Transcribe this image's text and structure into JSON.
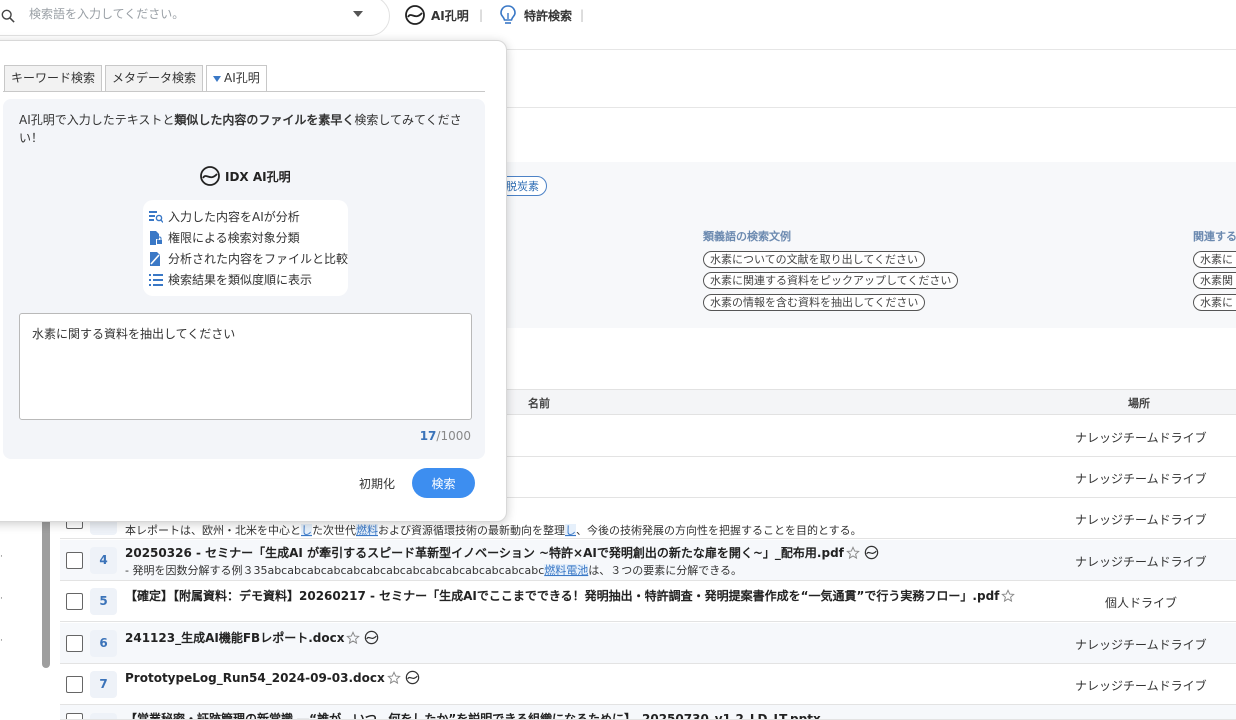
{
  "topbar": {
    "search_placeholder": "検索語を入力してください。",
    "nav_ai": "AI孔明",
    "nav_patent": "特許検索"
  },
  "page": {
    "tag_decarbon": "脱炭素",
    "synonym_title": "類義語の検索文例",
    "related_title": "関連する",
    "synonym_examples": [
      "水素についての文献を取り出してください",
      "水素に関連する資料をピックアップしてください",
      "水素の情報を含む資料を抽出してください"
    ],
    "related_examples": [
      "水素に",
      "水素関",
      "水素に"
    ],
    "col_name": "名前",
    "col_location": "場所"
  },
  "results": [
    {
      "num": "",
      "name": "",
      "snippet": "",
      "location": "ナレッジチームドライブ"
    },
    {
      "num": "",
      "name": "",
      "snippet": "",
      "location": "ナレッジチームドライブ"
    },
    {
      "num": "",
      "name": "",
      "snippet_a": "本レポートは、欧州・北米を中心と",
      "snippet_h1": "し",
      "snippet_b": "た次世代",
      "snippet_h2": "燃料",
      "snippet_c": "および資源循環技術の最新動向を整理",
      "snippet_h3": "し",
      "snippet_d": "、今後の技術発展の方向性を把握することを目的とする。",
      "location": "ナレッジチームドライブ"
    },
    {
      "num": "4",
      "name": "20250326 - セミナー「生成AI が牽引するスピード革新型イノベーション ~特許×AIで発明創出の新たな扉を開く~」_配布用.pdf",
      "snippet_a": "- 発明を因数分解する例３35abcabcabcabcabcabcabcabcabcabcabcabcabcabc",
      "snippet_h1": "燃料電池",
      "snippet_b": "は、３つの要素に分解できる。",
      "location": "ナレッジチームドライブ"
    },
    {
      "num": "5",
      "name": "【確定】【附属資料：デモ資料】20260217 - セミナー「生成AIでここまでできる！発明抽出・特許調査・発明提案書作成を“一気通貫”で行う実務フロー」.pdf",
      "location": "個人ドライブ"
    },
    {
      "num": "6",
      "name": "241123_生成AI機能FBレポート.docx",
      "location": "ナレッジチームドライブ"
    },
    {
      "num": "7",
      "name": "PrototypeLog_Run54_2024-09-03.docx",
      "location": "ナレッジチームドライブ"
    },
    {
      "num": "8",
      "name": "【営業秘密・証跡管理の新常識 ―“誰が、いつ、何をしたか”を説明できる組織になるために】_20250730_v1.2_LD_LT.pptx"
    }
  ],
  "popup": {
    "tabs": [
      "キーワード検索",
      "メタデータ検索",
      "AI孔明"
    ],
    "desc_pre": "AI孔明で入力したテキストと",
    "desc_bold": "類似した内容のファイルを素早く",
    "desc_post": "検索してみてください！",
    "logo_text": "IDX AI孔明",
    "features": [
      "入力した内容をAIが分析",
      "権限による検索対象分類",
      "分析された内容をファイルと比較",
      "検索結果を類似度順に表示"
    ],
    "query": "水素に関する資料を抽出してください",
    "count": "17",
    "max": "/1000",
    "reset_label": "初期化",
    "search_label": "検索"
  },
  "colors": {
    "accent": "#3d8ef0",
    "link": "#3b73b9",
    "tag_border": "#4c82c6"
  }
}
